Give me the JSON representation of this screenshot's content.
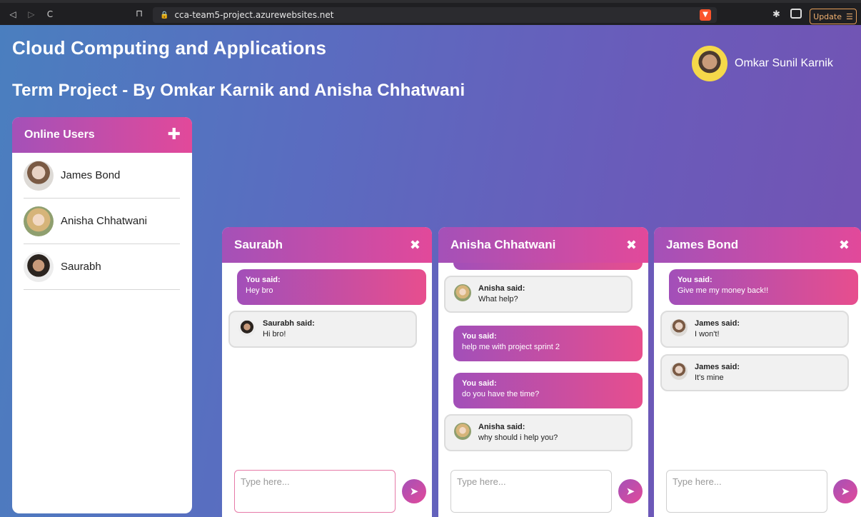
{
  "browser": {
    "url": "cca-team5-project.azurewebsites.net",
    "update_label": "Update"
  },
  "page": {
    "title": "Cloud Computing and Applications",
    "subtitle": "Term Project - By Omkar Karnik and Anisha Chhatwani",
    "current_user": "Omkar Sunil Karnik"
  },
  "online_users": {
    "title": "Online Users",
    "users": [
      {
        "name": "James Bond"
      },
      {
        "name": "Anisha Chhatwani"
      },
      {
        "name": "Saurabh"
      }
    ]
  },
  "chats": [
    {
      "title": "Saurabh",
      "placeholder": "Type here...",
      "messages": [
        {
          "from": "you",
          "label": "You said:",
          "text": "Hey bro"
        },
        {
          "from": "them",
          "label": "Saurabh said:",
          "text": "Hi bro!"
        }
      ]
    },
    {
      "title": "Anisha Chhatwani",
      "placeholder": "Type here...",
      "messages": [
        {
          "from": "them",
          "label": "Anisha said:",
          "text": "What help?"
        },
        {
          "from": "you",
          "label": "You said:",
          "text": "help me with project sprint 2"
        },
        {
          "from": "you",
          "label": "You said:",
          "text": "do you have the time?"
        },
        {
          "from": "them",
          "label": "Anisha said:",
          "text": "why should i help you?"
        }
      ]
    },
    {
      "title": "James Bond",
      "placeholder": "Type here...",
      "messages": [
        {
          "from": "you",
          "label": "You said:",
          "text": "Give me my money back!!"
        },
        {
          "from": "them",
          "label": "James said:",
          "text": "I won't!"
        },
        {
          "from": "them",
          "label": "James said:",
          "text": "It's mine"
        }
      ]
    }
  ],
  "colors": {
    "accent_start": "#a451b8",
    "accent_end": "#e2499a"
  }
}
